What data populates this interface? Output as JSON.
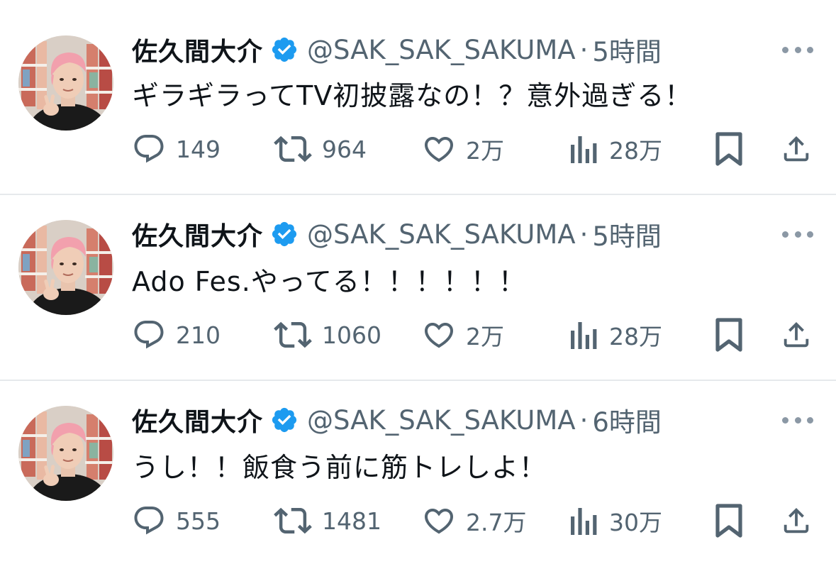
{
  "colors": {
    "text": "#0f1419",
    "secondary": "#536471",
    "verified": "#1d9bf0",
    "divider": "#e6e9ec"
  },
  "tweets": [
    {
      "name": "佐久間大介",
      "handle": "@SAK_SAK_SAKUMA",
      "separator": "·",
      "time": "5時間",
      "text": "ギラギラってTV初披露なの！？意外過ぎる！",
      "replies": "149",
      "retweets": "964",
      "likes": "2万",
      "views": "28万"
    },
    {
      "name": "佐久間大介",
      "handle": "@SAK_SAK_SAKUMA",
      "separator": "·",
      "time": "5時間",
      "text": "Ado Fes.やってる！！！！！！",
      "replies": "210",
      "retweets": "1060",
      "likes": "2万",
      "views": "28万"
    },
    {
      "name": "佐久間大介",
      "handle": "@SAK_SAK_SAKUMA",
      "separator": "·",
      "time": "6時間",
      "text": "うし！！飯食う前に筋トレしよ！",
      "replies": "555",
      "retweets": "1481",
      "likes": "2.7万",
      "views": "30万"
    }
  ],
  "icons": {
    "verified": "verified-badge-icon",
    "more": "more-options-icon",
    "reply": "reply-icon",
    "retweet": "retweet-icon",
    "like": "heart-icon",
    "views": "views-bar-chart-icon",
    "bookmark": "bookmark-icon",
    "share": "share-icon"
  }
}
